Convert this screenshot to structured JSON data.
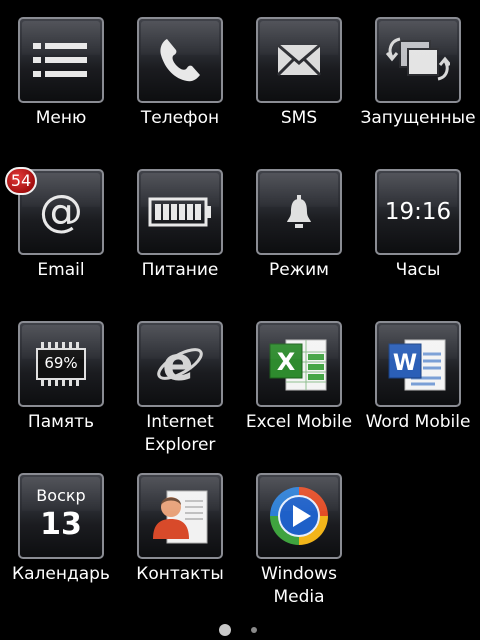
{
  "home": {
    "apps": [
      {
        "label": "Меню",
        "icon": "list-menu-icon"
      },
      {
        "label": "Телефон",
        "icon": "phone-handset-icon"
      },
      {
        "label": "SMS",
        "icon": "envelope-icon"
      },
      {
        "label": "Запущенные",
        "icon": "running-tasks-icon"
      },
      {
        "label": "Email",
        "icon": "at-sign-icon",
        "badge": "54"
      },
      {
        "label": "Питание",
        "icon": "battery-icon"
      },
      {
        "label": "Режим",
        "icon": "bell-icon"
      },
      {
        "label": "Часы",
        "icon": "clock-icon",
        "value": "19:16"
      },
      {
        "label": "Память",
        "icon": "memory-chip-icon",
        "value": "69%"
      },
      {
        "label_lines": [
          "Internet",
          "Explorer"
        ],
        "icon": "internet-explorer-icon"
      },
      {
        "label": "Excel Mobile",
        "icon": "excel-icon"
      },
      {
        "label": "Word Mobile",
        "icon": "word-icon"
      },
      {
        "label": "Календарь",
        "icon": "calendar-icon",
        "day": "Воскр",
        "date": "13"
      },
      {
        "label": "Контакты",
        "icon": "contacts-icon"
      },
      {
        "label_lines": [
          "Windows",
          "Media"
        ],
        "icon": "windows-media-icon"
      }
    ]
  },
  "pager": {
    "pages": 2,
    "current": 1
  },
  "colors": {
    "background": "#000000",
    "tile_border": "#8a8c93",
    "badge": "#c01818",
    "excel_green": "#2e8b2e",
    "word_blue": "#2b5fb7",
    "media_blue": "#1e60c8"
  }
}
